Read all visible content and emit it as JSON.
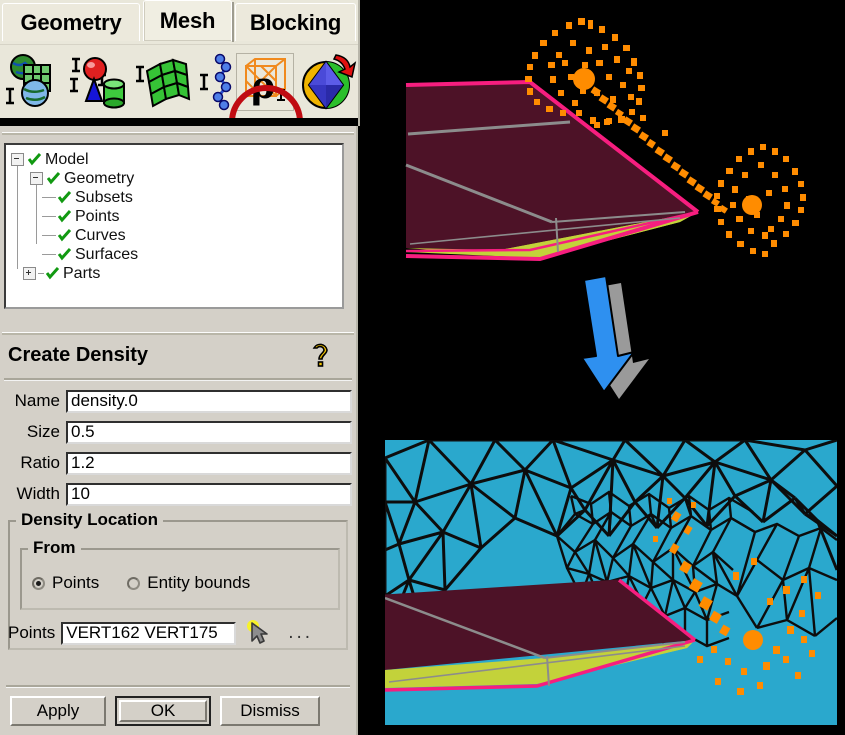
{
  "app": {
    "tabs": [
      {
        "label": "Geometry",
        "active": false
      },
      {
        "label": "Mesh",
        "active": true
      },
      {
        "label": "Blocking",
        "active": false
      }
    ],
    "toolbar": {
      "icons": [
        {
          "name": "create-geometry-icon",
          "title": "Create Geometry"
        },
        {
          "name": "create-primitive-icon",
          "title": "Create Primitive"
        },
        {
          "name": "surface-mesh-icon",
          "title": "Surface Mesh Setup"
        },
        {
          "name": "curve-mesh-icon",
          "title": "Curve Mesh Setup"
        },
        {
          "name": "create-density-icon",
          "title": "Create Mesh Density"
        },
        {
          "name": "compute-mesh-icon",
          "title": "Compute Mesh"
        }
      ],
      "highlighted_icon": "create-density-icon",
      "highlight_color": "#c00b12"
    }
  },
  "tree": {
    "nodes": [
      {
        "label": "Model",
        "indent": 0,
        "expander": "minus",
        "checked": true
      },
      {
        "label": "Geometry",
        "indent": 1,
        "expander": "minus",
        "checked": true
      },
      {
        "label": "Subsets",
        "indent": 2,
        "expander": "none",
        "checked": true
      },
      {
        "label": "Points",
        "indent": 2,
        "expander": "none",
        "checked": true
      },
      {
        "label": "Curves",
        "indent": 2,
        "expander": "none",
        "checked": true
      },
      {
        "label": "Surfaces",
        "indent": 2,
        "expander": "none",
        "checked": true
      },
      {
        "label": "Parts",
        "indent": 1,
        "expander": "plus",
        "checked": true
      }
    ],
    "check_color": "#119911"
  },
  "form": {
    "title": "Create Density",
    "help_icon": "question-mark-icon",
    "fields": [
      {
        "label": "Name",
        "value": "density.0",
        "placeholder": ""
      },
      {
        "label": "Size",
        "value": "0.5",
        "placeholder": ""
      },
      {
        "label": "Ratio",
        "value": "1.2",
        "placeholder": ""
      },
      {
        "label": "Width",
        "value": "10",
        "placeholder": ""
      }
    ],
    "location_group": {
      "legend": "Density Location",
      "from_group": {
        "legend": "From",
        "options": [
          {
            "label": "Points",
            "selected": true
          },
          {
            "label": "Entity bounds",
            "selected": false
          }
        ]
      },
      "points": {
        "label": "Points",
        "value": "VERT162 VERT175",
        "placeholder": "",
        "select_icon": "mouse-cursor-icon",
        "more_button": "..."
      }
    },
    "buttons": [
      {
        "label": "Apply",
        "default": false
      },
      {
        "label": "OK",
        "default": true
      },
      {
        "label": "Dismiss",
        "default": false
      }
    ]
  },
  "viewports": {
    "top": {
      "name": "geometry-density-view",
      "background": "#000000",
      "geometry_colors": {
        "wedge_upper": "#4d1227",
        "wedge_lower": "#c3d23a",
        "edge_pink": "#f61e7f",
        "edge_gray": "#8c8c8c"
      },
      "density_points_color": "#ff8c00",
      "description": "Geometry wing cross-section with two orange spherical density point clouds linked by a line"
    },
    "bottom": {
      "name": "mesh-result-view",
      "background": "#2aa8cd",
      "mesh_edge_color": "#0d0d0d",
      "geometry_colors": {
        "wedge_upper": "#4d1227",
        "wedge_lower": "#c3d23a",
        "edge_pink": "#f61e7f"
      },
      "density_points_color": "#ff8c00",
      "description": "Refined triangular surface mesh clustered around the density region"
    },
    "arrow": {
      "name": "flow-arrow",
      "color": "#2e90f0",
      "shadow_color": "#9a9a9a",
      "direction": "down"
    }
  }
}
